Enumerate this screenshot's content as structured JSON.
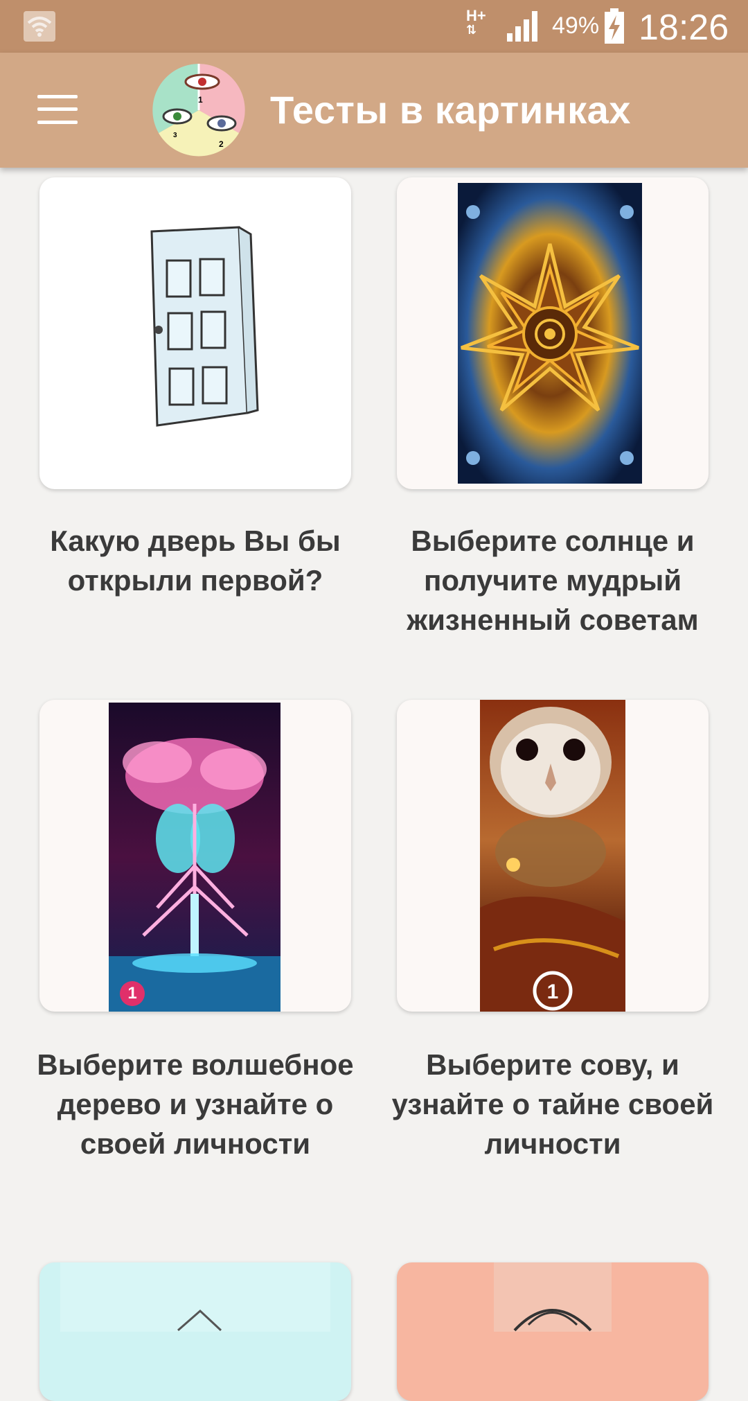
{
  "statusbar": {
    "network": "H+",
    "battery_percent": "49%",
    "time": "18:26"
  },
  "appbar": {
    "title": "Тесты в картинках",
    "menu_icon": "hamburger-menu-icon",
    "logo_numbers": [
      "1",
      "2",
      "3"
    ]
  },
  "tests": [
    {
      "title": "Какую дверь Вы бы открыли первой?"
    },
    {
      "title": "Выберите солнце и получите мудрый жизненный советам"
    },
    {
      "title": "Выберите волшебное дерево и узнайте о своей личности",
      "badge": "1"
    },
    {
      "title": "Выберите сову, и узнайте о тайне своей личности",
      "badge": "1"
    },
    {
      "title": ""
    },
    {
      "title": ""
    }
  ],
  "colors": {
    "statusbar": "#bf8f6b",
    "appbar": "#d2a886",
    "background": "#f3f2f0"
  }
}
